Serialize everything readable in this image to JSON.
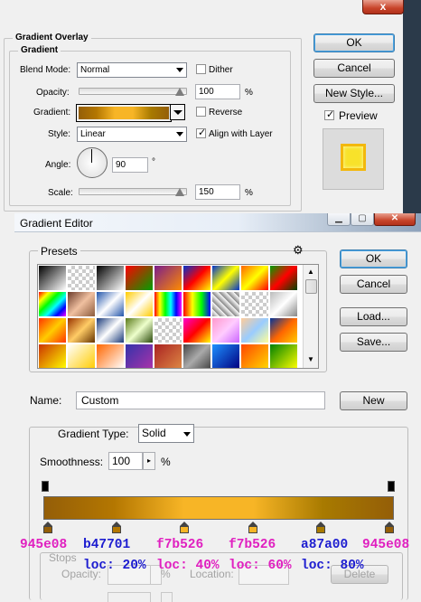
{
  "layer_style": {
    "section_title": "Gradient Overlay",
    "subsection_title": "Gradient",
    "blend_mode_label": "Blend Mode:",
    "blend_mode_value": "Normal",
    "dither_label": "Dither",
    "opacity_label": "Opacity:",
    "opacity_value": "100",
    "opacity_unit": "%",
    "gradient_label": "Gradient:",
    "reverse_label": "Reverse",
    "style_label": "Style:",
    "style_value": "Linear",
    "align_label": "Align with Layer",
    "angle_label": "Angle:",
    "angle_value": "90",
    "angle_unit": "°",
    "scale_label": "Scale:",
    "scale_value": "150",
    "scale_unit": "%",
    "close_glyph": "x",
    "ok_label": "OK",
    "cancel_label": "Cancel",
    "new_style_label": "New Style...",
    "preview_label": "Preview",
    "dither_checked": false,
    "reverse_checked": false,
    "align_checked": true,
    "preview_checked": true
  },
  "gradient_editor": {
    "title": "Gradient Editor",
    "presets_label": "Presets",
    "gear_glyph": "⚙",
    "ok_label": "OK",
    "cancel_label": "Cancel",
    "load_label": "Load...",
    "save_label": "Save...",
    "name_label": "Name:",
    "name_value": "Custom",
    "new_label": "New",
    "gradient_type_label": "Gradient Type:",
    "gradient_type_value": "Solid",
    "smoothness_label": "Smoothness:",
    "smoothness_value": "100",
    "smoothness_unit": "%",
    "stops_label": "Stops",
    "stop_opacity_label": "Opacity:",
    "stop_opacity_unit": "%",
    "stop_location_label": "Location:",
    "stop_delete_label": "Delete",
    "colors": {
      "gradient": [
        "#945e08",
        "#b47701",
        "#f7b526",
        "#f7b526",
        "#a87a00",
        "#945e08"
      ]
    }
  },
  "annotations": [
    {
      "hex": "945e08",
      "loc": "",
      "color": "#e020c0"
    },
    {
      "hex": "b47701",
      "loc": "loc: 20%",
      "color": "#1d1dd0"
    },
    {
      "hex": "f7b526",
      "loc": "loc: 40%",
      "color": "#e020c0"
    },
    {
      "hex": "f7b526",
      "loc": "loc: 60%",
      "color": "#e020c0"
    },
    {
      "hex": "a87a00",
      "loc": "loc: 80%",
      "color": "#1d1dd0"
    },
    {
      "hex": "945e08",
      "loc": "",
      "color": "#e020c0"
    }
  ]
}
